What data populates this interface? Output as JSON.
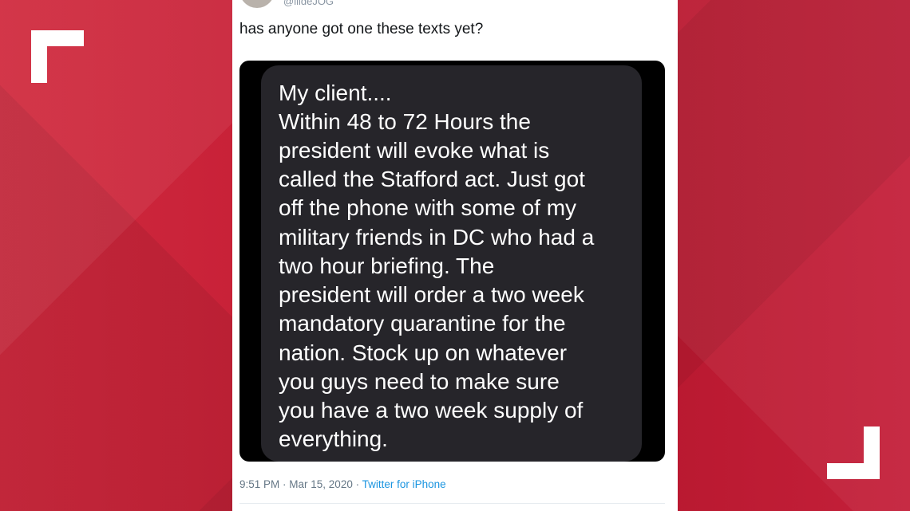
{
  "tweet": {
    "handle": "@lildeJOG",
    "text": "has anyone got one these texts yet?",
    "message_lines": [
      "My client....",
      "Within 48 to 72 Hours the",
      "president will evoke what is",
      "called the Stafford act. Just got",
      "off the phone with some of my",
      "military friends in DC who had a",
      "two hour briefing. The",
      "president will order a two week",
      "mandatory quarantine for the",
      "nation. Stock up on whatever",
      "you guys need to make sure",
      "you have a two week supply of",
      "everything."
    ],
    "time": "9:51 PM",
    "separator": " · ",
    "date": "Mar 15, 2020",
    "source": "Twitter for iPhone"
  },
  "colors": {
    "background_red": "#c8203a",
    "bubble": "#26252a",
    "link_blue": "#1b95e0"
  }
}
